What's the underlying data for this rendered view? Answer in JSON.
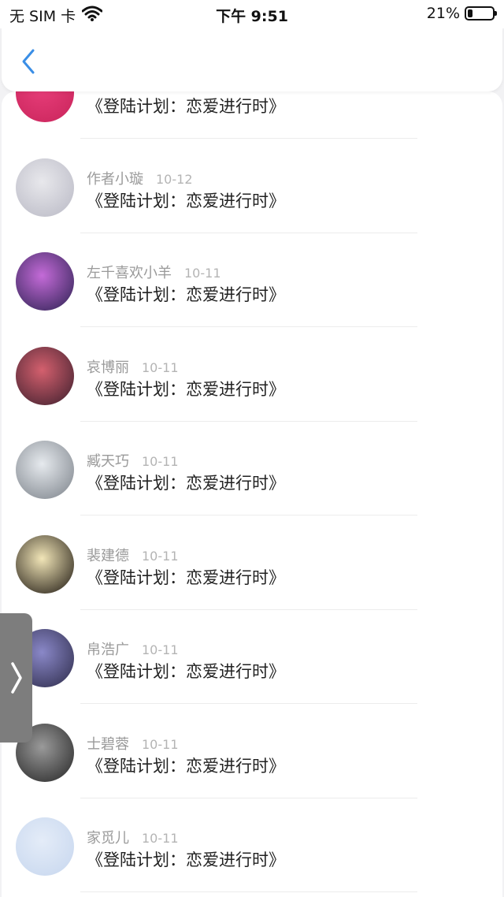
{
  "status_bar": {
    "carrier": "无 SIM 卡",
    "time": "下午 9:51",
    "battery_percent": "21%",
    "battery_level": 0.21
  },
  "nav": {
    "back_icon": "chevron-left-icon",
    "accent_color": "#3a8ee6"
  },
  "comments": [
    {
      "name": "",
      "date": "",
      "text": "《登陆计划：恋爱进行时》",
      "avatar_colors": [
        "#e83e7a",
        "#c8245a"
      ]
    },
    {
      "name": "作者小璇",
      "date": "10-12",
      "text": "《登陆计划：恋爱进行时》",
      "avatar_colors": [
        "#e8e8ec",
        "#b8b8c4"
      ]
    },
    {
      "name": "左千喜欢小羊",
      "date": "10-11",
      "text": "《登陆计划：恋爱进行时》",
      "avatar_colors": [
        "#c46bd8",
        "#2a2050"
      ]
    },
    {
      "name": "哀博丽",
      "date": "10-11",
      "text": "《登陆计划：恋爱进行时》",
      "avatar_colors": [
        "#d4606e",
        "#3a1e2c"
      ]
    },
    {
      "name": "臧天巧",
      "date": "10-11",
      "text": "《登陆计划：恋爱进行时》",
      "avatar_colors": [
        "#e6eaee",
        "#7a8088"
      ]
    },
    {
      "name": "裴建德",
      "date": "10-11",
      "text": "《登陆计划：恋爱进行时》",
      "avatar_colors": [
        "#f2e6b8",
        "#1a140e"
      ]
    },
    {
      "name": "帛浩广",
      "date": "10-11",
      "text": "《登陆计划：恋爱进行时》",
      "avatar_colors": [
        "#8a88c8",
        "#2c2a48"
      ]
    },
    {
      "name": "士碧蓉",
      "date": "10-11",
      "text": "《登陆计划：恋爱进行时》",
      "avatar_colors": [
        "#9a9a9a",
        "#242424"
      ]
    },
    {
      "name": "家觅儿",
      "date": "10-11",
      "text": "《登陆计划：恋爱进行时》",
      "avatar_colors": [
        "#e4ecf8",
        "#c6d6ee"
      ]
    }
  ],
  "side_handle": {
    "icon": "chevron-right-icon"
  }
}
